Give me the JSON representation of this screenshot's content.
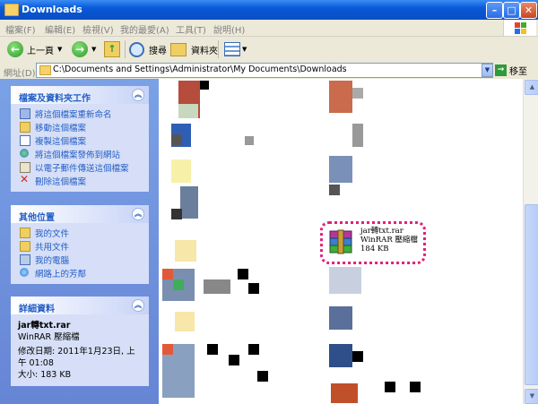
{
  "window": {
    "title": "Downloads"
  },
  "menu": [
    "檔案(F)",
    "編輯(E)",
    "檢視(V)",
    "我的最愛(A)",
    "工具(T)",
    "說明(H)"
  ],
  "toolbar": {
    "back_label": "上一頁",
    "search_label": "搜尋",
    "folders_label": "資料夾"
  },
  "address": {
    "label": "網址(D)",
    "path": "C:\\Documents and Settings\\Administrator\\My Documents\\Downloads",
    "go_label": "移至"
  },
  "file_tasks": {
    "title": "檔案及資料夾工作",
    "items": [
      "將這個檔案重新命名",
      "移動這個檔案",
      "複製這個檔案",
      "將這個檔案發佈到網站",
      "以電子郵件傳送這個檔案",
      "刪除這個檔案"
    ]
  },
  "other_places": {
    "title": "其他位置",
    "items": [
      "我的文件",
      "共用文件",
      "我的電腦",
      "網路上的芳鄰"
    ]
  },
  "details": {
    "title": "詳細資料",
    "name": "jar轉txt.rar",
    "type": "WinRAR 壓縮檔",
    "modified": "修改日期: 2011年1月23日, 上午 01:08",
    "size": "大小: 183 KB"
  },
  "selected_file": {
    "name": "jar轉txt.rar",
    "type": "WinRAR 壓縮檔",
    "size": "184 KB"
  },
  "colors": {
    "accent": "#215dc6",
    "highlight": "#e0207a"
  }
}
